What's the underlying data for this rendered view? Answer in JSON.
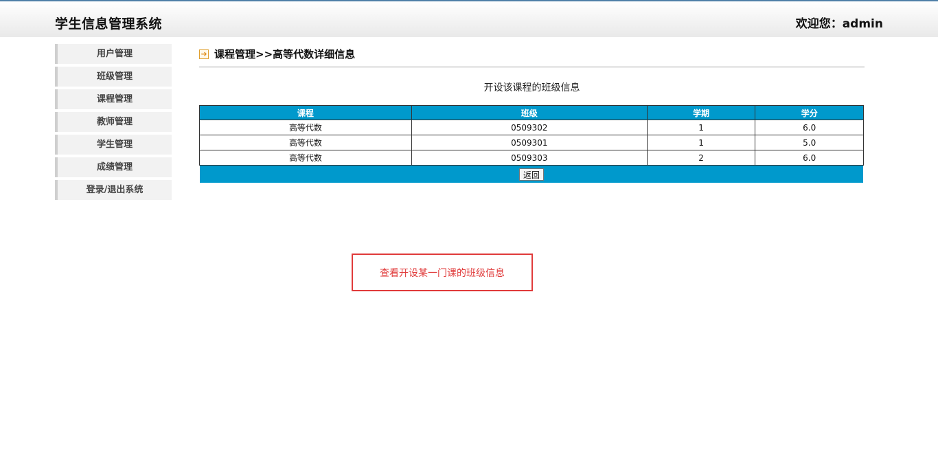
{
  "header": {
    "app_title": "学生信息管理系统",
    "welcome": "欢迎您：admin"
  },
  "sidebar": {
    "items": [
      {
        "label": "用户管理"
      },
      {
        "label": "班级管理"
      },
      {
        "label": "课程管理"
      },
      {
        "label": "教师管理"
      },
      {
        "label": "学生管理"
      },
      {
        "label": "成绩管理"
      },
      {
        "label": "登录/退出系统"
      }
    ]
  },
  "main": {
    "breadcrumb": "课程管理>>高等代数详细信息",
    "section_title": "开设该课程的班级信息",
    "table": {
      "headers": [
        "课程",
        "班级",
        "学期",
        "学分"
      ],
      "rows": [
        [
          "高等代数",
          "0509302",
          "1",
          "6.0"
        ],
        [
          "高等代数",
          "0509301",
          "1",
          "5.0"
        ],
        [
          "高等代数",
          "0509303",
          "2",
          "6.0"
        ]
      ]
    },
    "back_label": "返回"
  },
  "annotation": "查看开设某一门课的班级信息",
  "icons": {
    "breadcrumb_icon": "arrow-right-icon"
  },
  "colors": {
    "table_header": "#0099cc",
    "annotation": "#e03a3a"
  }
}
